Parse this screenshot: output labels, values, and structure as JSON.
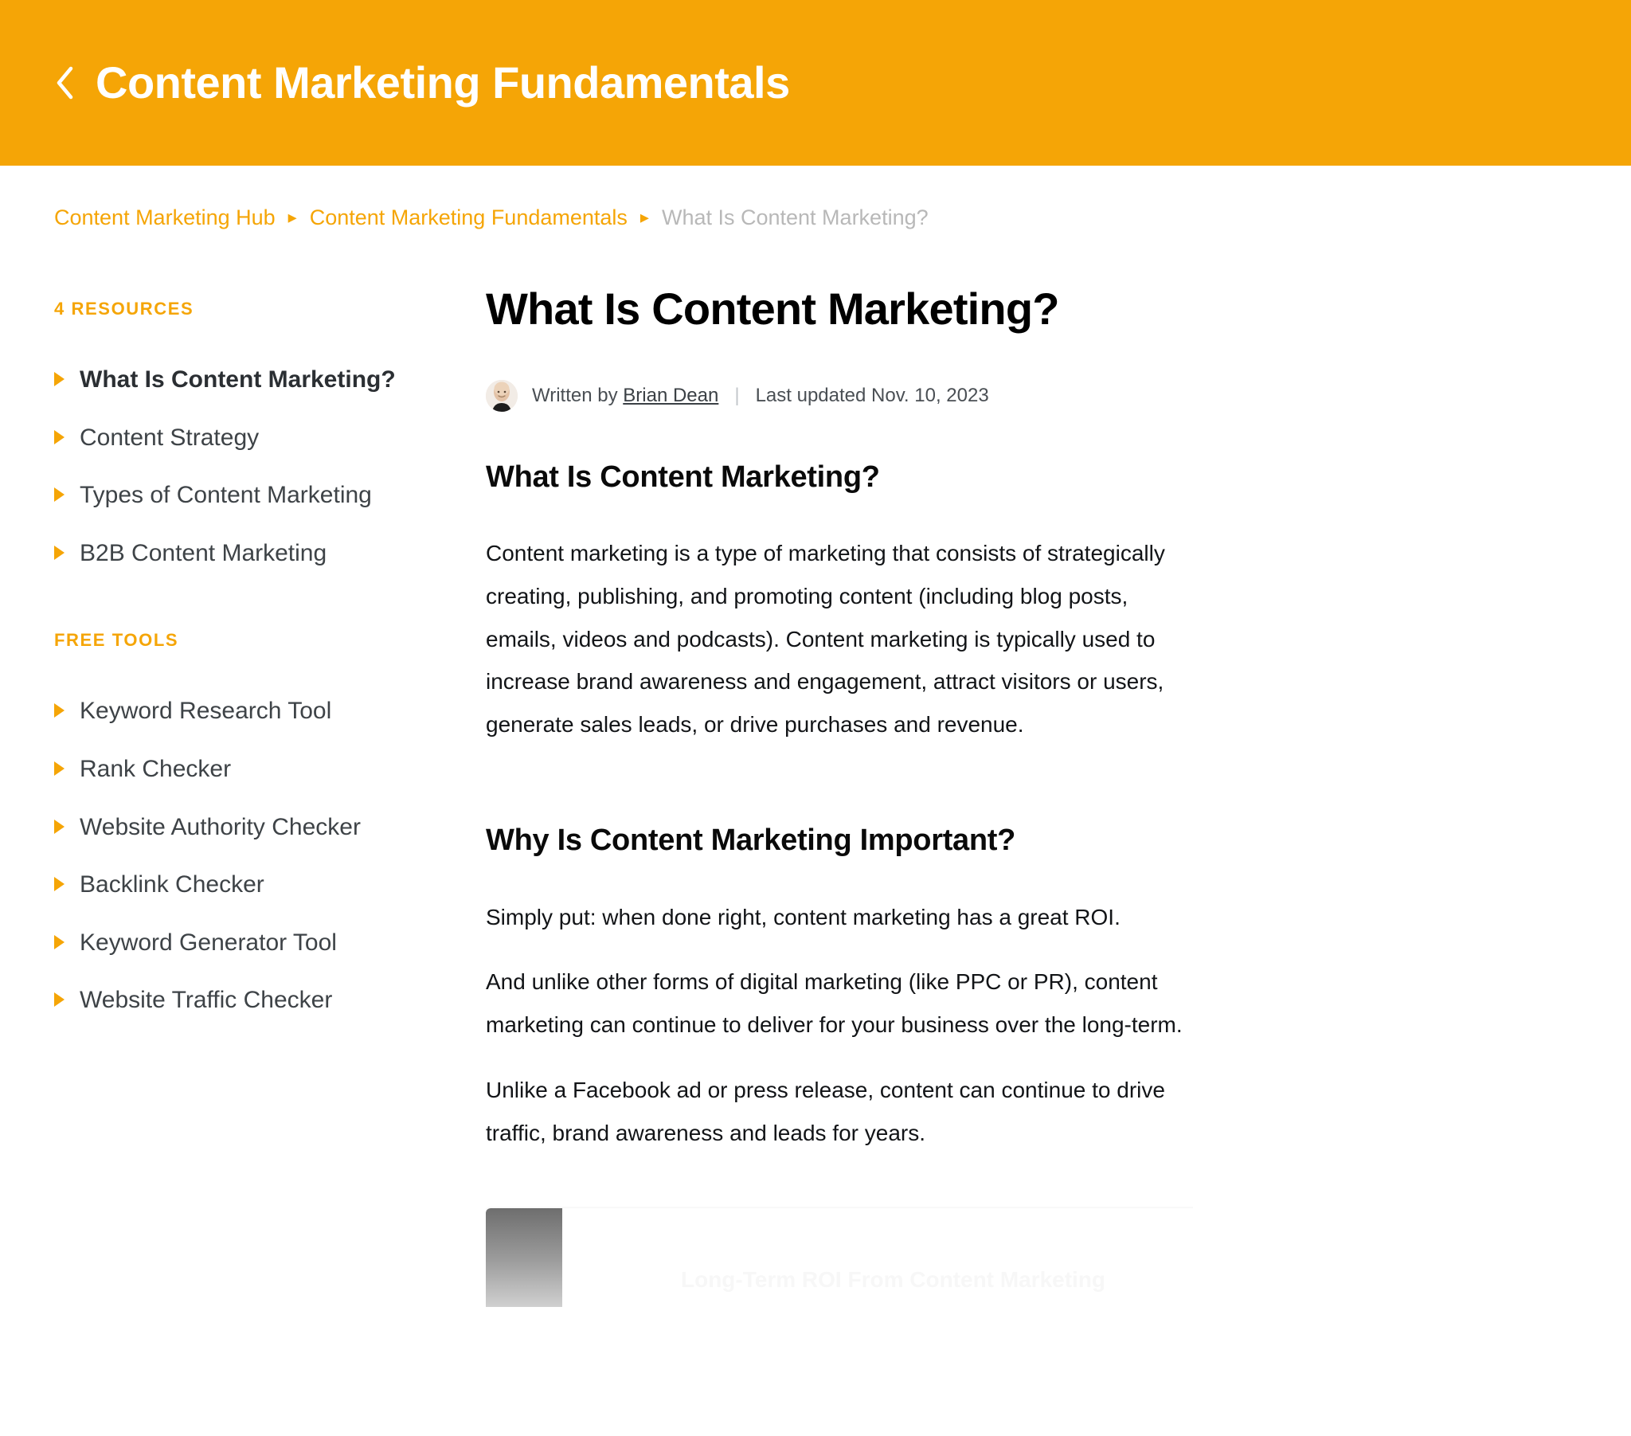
{
  "header": {
    "back_icon": "chevron-left-icon",
    "title": "Content Marketing Fundamentals",
    "background_color": "#F5A506"
  },
  "breadcrumb": {
    "items": [
      {
        "label": "Content Marketing Hub",
        "current": false
      },
      {
        "label": "Content Marketing Fundamentals",
        "current": false
      },
      {
        "label": "What Is Content Marketing?",
        "current": true
      }
    ],
    "separator": "▸",
    "link_color": "#F5A506",
    "current_color": "#b8b8b8"
  },
  "sidebar": {
    "resources": {
      "heading": "4 RESOURCES",
      "items": [
        {
          "label": "What Is Content Marketing?",
          "active": true
        },
        {
          "label": "Content Strategy",
          "active": false
        },
        {
          "label": "Types of Content Marketing",
          "active": false
        },
        {
          "label": "B2B Content Marketing",
          "active": false
        }
      ]
    },
    "tools": {
      "heading": "FREE TOOLS",
      "items": [
        {
          "label": "Keyword Research Tool"
        },
        {
          "label": "Rank Checker"
        },
        {
          "label": "Website Authority Checker"
        },
        {
          "label": "Backlink Checker"
        },
        {
          "label": "Keyword Generator Tool"
        },
        {
          "label": "Website Traffic Checker"
        }
      ]
    },
    "bullet_icon": "triangle-right-icon",
    "bullet_color": "#F5A506"
  },
  "article": {
    "title": "What Is Content Marketing?",
    "byline": {
      "avatar_icon": "author-avatar",
      "written_by_prefix": "Written by",
      "author": "Brian Dean",
      "divider": "|",
      "updated": "Last updated Nov. 10, 2023"
    },
    "sections": [
      {
        "heading": "What Is Content Marketing?",
        "paragraphs": [
          "Content marketing is a type of marketing that consists of strategically creating, publishing, and promoting content (including blog posts, emails, videos and podcasts). Content marketing is typically used to increase brand awareness and engagement, attract visitors or users, generate sales leads, or drive purchases and revenue."
        ]
      },
      {
        "heading": "Why Is Content Marketing Important?",
        "paragraphs": [
          "Simply put: when done right, content marketing has a great ROI.",
          "And unlike other forms of digital marketing (like PPC or PR), content marketing can continue to deliver for your business over the long-term.",
          "Unlike a Facebook ad or press release, content can continue to drive traffic, brand awareness and leads for years."
        ]
      }
    ],
    "figure": {
      "caption": "Long-Term ROI From Content Marketing",
      "type": "image-placeholder"
    }
  }
}
